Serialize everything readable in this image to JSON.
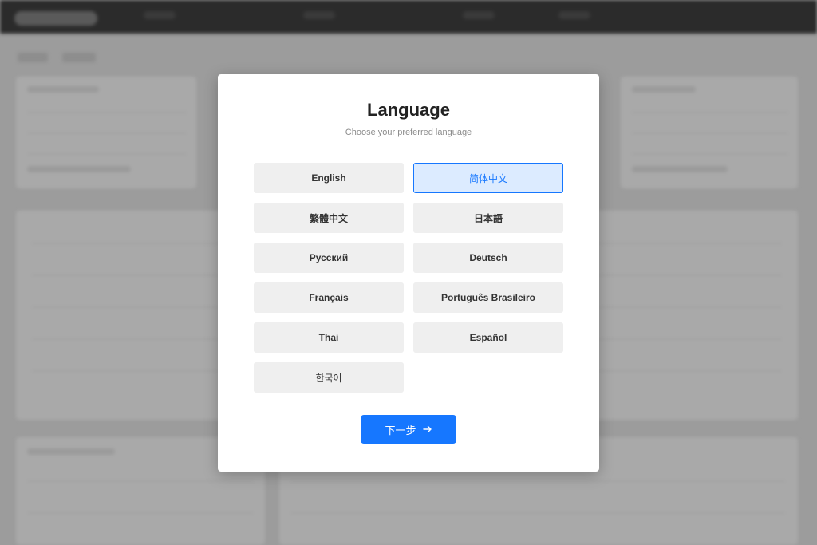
{
  "dialog": {
    "title": "Language",
    "subtitle": "Choose your preferred language"
  },
  "languages": [
    {
      "label": "English",
      "selected": false
    },
    {
      "label": "简体中文",
      "selected": true
    },
    {
      "label": "繁體中文",
      "selected": false
    },
    {
      "label": "日本語",
      "selected": false
    },
    {
      "label": "Русский",
      "selected": false
    },
    {
      "label": "Deutsch",
      "selected": false
    },
    {
      "label": "Français",
      "selected": false
    },
    {
      "label": "Português Brasileiro",
      "selected": false
    },
    {
      "label": "Thai",
      "selected": false
    },
    {
      "label": "Español",
      "selected": false
    },
    {
      "label": "한국어",
      "selected": false
    }
  ],
  "next_button": {
    "label": "下一步",
    "icon": "arrow-right-icon"
  },
  "colors": {
    "accent": "#1677ff",
    "selected_bg": "#dcebff",
    "option_bg": "#efefef",
    "overlay": "#9c9c9c"
  }
}
